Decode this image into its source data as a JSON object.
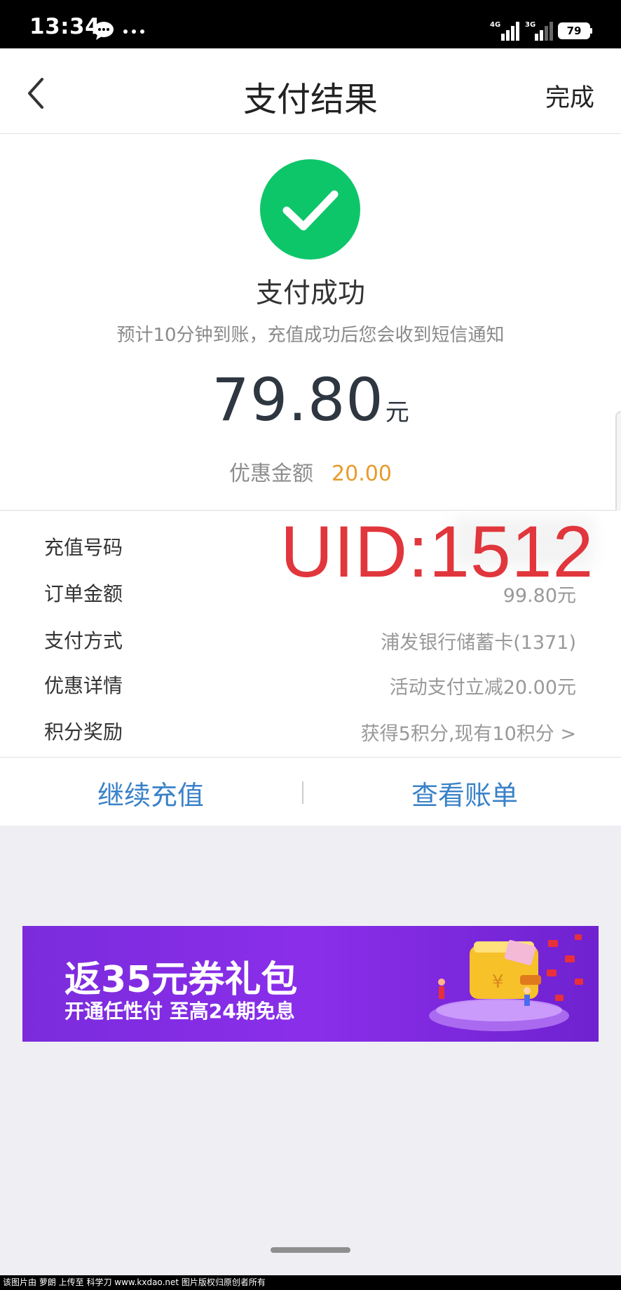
{
  "status_bar": {
    "time": "13:34",
    "network_1": "4G",
    "network_2": "3G",
    "battery": "79",
    "icons": [
      "chat-bubble-icon",
      "more-dots-icon",
      "signal-icon",
      "battery-icon"
    ]
  },
  "header": {
    "title": "支付结果",
    "done_label": "完成",
    "back_icon": "chevron-left-icon"
  },
  "result": {
    "status_icon": "check-circle-icon",
    "status_color": "#0ec66a",
    "status_text": "支付成功",
    "notice": "预计10分钟到账，充值成功后您会收到短信通知",
    "amount": "79.80",
    "amount_unit": "元",
    "discount_label": "优惠金额",
    "discount_value": "20.00"
  },
  "details": {
    "rows": [
      {
        "label": "充值号码",
        "value": ""
      },
      {
        "label": "订单金额",
        "value": "99.80元"
      },
      {
        "label": "支付方式",
        "value": "浦发银行储蓄卡(1371)"
      },
      {
        "label": "优惠详情",
        "value": "活动支付立减20.00元"
      },
      {
        "label": "积分奖励",
        "value": "获得5积分,现有10积分 >"
      }
    ],
    "overlay_stamp": "UID:1512"
  },
  "actions": {
    "continue_label": "继续充值",
    "bill_label": "查看账单"
  },
  "banner": {
    "title": "返35元券礼包",
    "subtitle": "开通任性付 至高24期免息",
    "art_icon": "wallet-gift-icon"
  },
  "footer": {
    "text": "该图片由 萝朗 上传至 科学刀 www.kxdao.net 图片版权归原创者所有"
  },
  "colors": {
    "accent_blue": "#3a82c8",
    "discount_orange": "#e89a2a",
    "stamp_red": "#e0363c",
    "banner_purple": "#8a2eea"
  }
}
